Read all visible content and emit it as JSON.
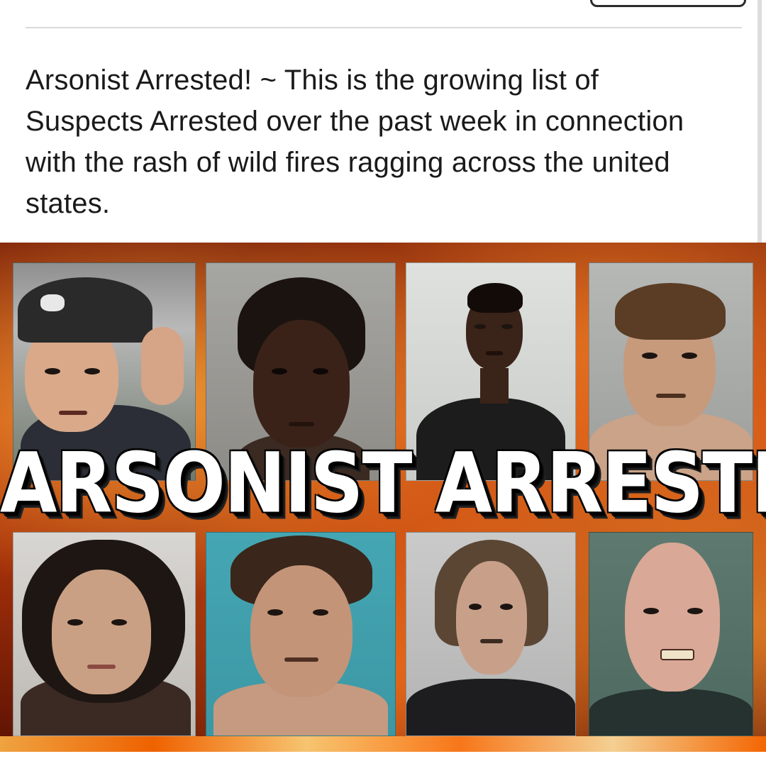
{
  "post": {
    "text": "Arsonist Arrested! ~ This is the growing list of Suspects Arrested over the past week in connection with the rash of wild fires ragging across the united states."
  },
  "image": {
    "headline": "ARSONIST ARRESTED!",
    "colors": {
      "fire_dark": "#7a1d08",
      "fire_mid": "#c2410f",
      "fire_light": "#ffb347",
      "headline_text": "#ffffff",
      "headline_shadow": "#000000"
    }
  }
}
